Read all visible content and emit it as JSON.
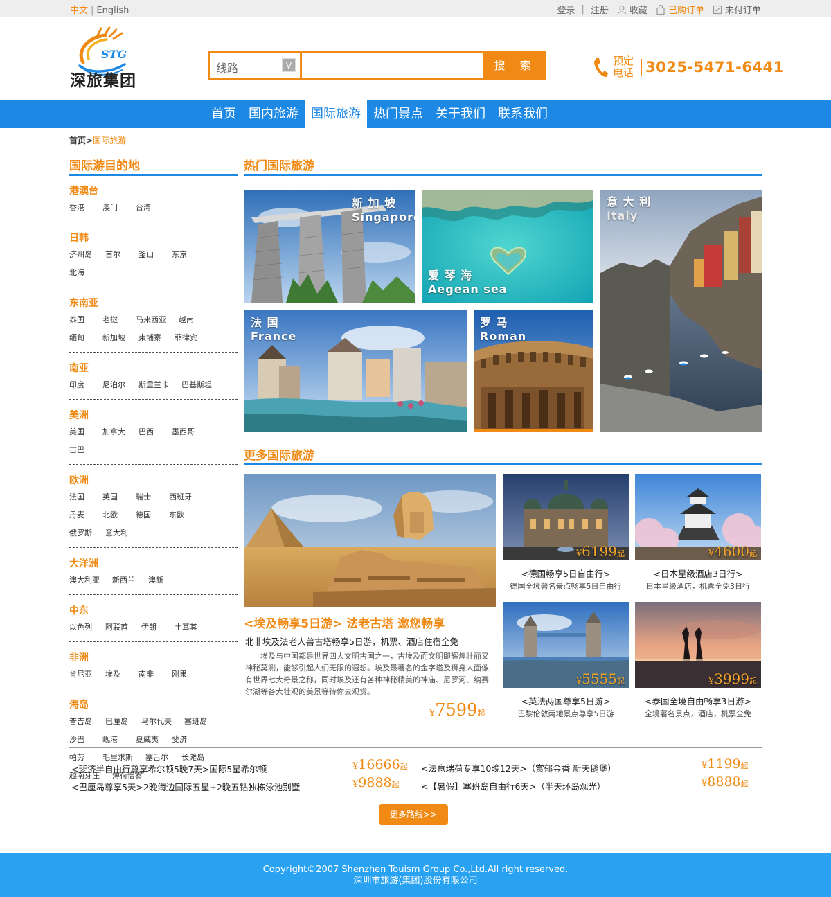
{
  "topbar": {
    "lang_active": "中文",
    "lang_other": "English",
    "login": "登录",
    "register": "注册",
    "favorites": "收藏",
    "purchased": "已购订单",
    "unpaid": "未付订单"
  },
  "header": {
    "logo_text": "深旅集团",
    "logo_badge": "STG",
    "search_category": "线路",
    "search_dropdown": "V",
    "search_value": "",
    "search_button": "搜 索",
    "phone_label_1": "预定",
    "phone_label_2": "电话",
    "phone_number": "3025-5471-6441"
  },
  "nav": {
    "items": [
      {
        "label": "首页"
      },
      {
        "label": "国内旅游"
      },
      {
        "label": "国际旅游"
      },
      {
        "label": "热门景点"
      },
      {
        "label": "关于我们"
      },
      {
        "label": "联系我们"
      }
    ],
    "active_index": 2
  },
  "breadcrumb": {
    "home": "首页",
    "separator": ">",
    "current": "国际旅游"
  },
  "sidebar": {
    "title": "国际游目的地",
    "regions": [
      {
        "name": "港澳台",
        "cities": [
          "香港",
          "澳门",
          "台湾"
        ]
      },
      {
        "name": "日韩",
        "cities": [
          "济州岛",
          "首尔",
          "釜山",
          "东京",
          "北海"
        ]
      },
      {
        "name": "东南亚",
        "cities": [
          "泰国",
          "老挝",
          "马来西亚",
          "越南",
          "缅甸",
          "新加坡",
          "柬埔寨",
          "菲律宾"
        ]
      },
      {
        "name": "南亚",
        "cities": [
          "印度",
          "尼泊尔",
          "斯里兰卡",
          "巴基斯坦"
        ]
      },
      {
        "name": "美洲",
        "cities": [
          "美国",
          "加拿大",
          "巴西",
          "墨西哥",
          "古巴"
        ]
      },
      {
        "name": "欧洲",
        "cities": [
          "法国",
          "英国",
          "瑞士",
          "西班牙",
          "丹麦",
          "北欧",
          "德国",
          "东欧",
          "俄罗斯",
          "意大利"
        ]
      },
      {
        "name": "大洋洲",
        "cities": [
          "澳大利亚",
          "新西兰",
          "澳新"
        ]
      },
      {
        "name": "中东",
        "cities": [
          "以色列",
          "阿联酋",
          "伊朗",
          "土耳其"
        ]
      },
      {
        "name": "非洲",
        "cities": [
          "肯尼亚",
          "埃及",
          "南非",
          "刚果"
        ]
      },
      {
        "name": "海岛",
        "cities": [
          "普吉岛",
          "巴厘岛",
          "马尔代夫",
          "塞班岛",
          "沙巴",
          "岘港",
          "夏威夷",
          "斐济",
          "帕劳",
          "毛里求斯",
          "塞舌尔",
          "长滩岛",
          "越南芽庄",
          "薄荷僧雾"
        ]
      }
    ]
  },
  "hot": {
    "title": "热门国际旅游",
    "tiles": [
      {
        "cn": "新 加 坡",
        "en": "Singapore"
      },
      {
        "cn": "爱 琴 海",
        "en": "Aegean sea"
      },
      {
        "cn": "意 大 利",
        "en": "Italy"
      },
      {
        "cn": "法 国",
        "en": "France"
      },
      {
        "cn": "罗 马",
        "en": "Roman"
      }
    ]
  },
  "more": {
    "title": "更多国际旅游",
    "featured": {
      "title": "<埃及畅享5日游> 法老古塔 邀您畅享",
      "subtitle": "北非埃及法老人兽古塔畅享5日游，机票、酒店住宿全免",
      "description": "埃及与中国都是世界四大文明古国之一，古埃及而文明即辉煌壮丽又神秘莫测，能够引起人们无限的遐想。埃及最著名的金字塔及狮身人面像有世界七大奇景之称，同时埃及还有各种神秘精美的神庙、尼罗河、纳赛尔湖等各大壮观的美景等待你去观赏。",
      "price": "7599",
      "currency": "¥",
      "suffix": "起"
    },
    "cards": [
      {
        "price": "6199",
        "title": "<德国畅享5日自由行>",
        "subtitle": "德国全境著名景点畅享5日自由行"
      },
      {
        "price": "4600",
        "title": "<日本星级酒店3日行>",
        "subtitle": "日本星级酒店，机票全免3日行"
      },
      {
        "price": "5555",
        "title": "<英法两国尊享5日游>",
        "subtitle": "巴黎伦敦两地景点尊享5日游"
      },
      {
        "price": "3999",
        "title": "<泰国全境自由畅享3日游>",
        "subtitle": "全境著名景点，酒店，机票全免"
      }
    ],
    "currency": "¥",
    "suffix": "起"
  },
  "routes": [
    {
      "text": "<斐济半自由行尊享希尔顿5晚7天>国际5星希尔顿",
      "price": "16666"
    },
    {
      "text": "<巴厘岛尊享5天>2晚海边国际五星+2晚五钻独栋泳池别墅",
      "price": "9888"
    },
    {
      "text": "<法意瑞荷专享10晚12天>（赏郁金香 新天鹅堡）",
      "price": "1199"
    },
    {
      "text": "<【暑假】塞班岛自由行6天>（半天环岛观光）",
      "price": "8888"
    }
  ],
  "more_button": "更多路线>>",
  "footer": {
    "line1": "Copyright©2007 Shenzhen Touism Group Co.,Ltd.All right reserved.",
    "line2": "深圳市旅游(集团)股份有限公司"
  }
}
